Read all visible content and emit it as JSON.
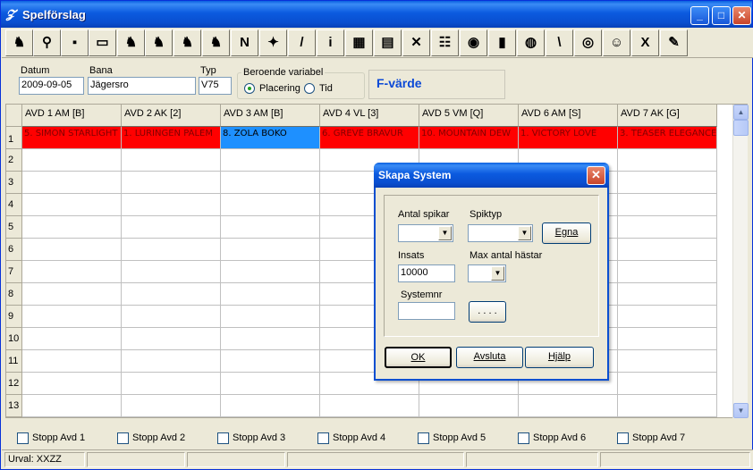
{
  "window": {
    "title": "Spelförslag"
  },
  "toolbar": {
    "icons": [
      "horse-icon",
      "binoculars-icon",
      "save-icon",
      "open-folder-icon",
      "horse-icon-2",
      "horse-icon-3",
      "horse-icon-4",
      "horse-icon-5",
      "horse-n-icon",
      "paw-icon",
      "pencil-icon",
      "info-icon",
      "grid-icon",
      "print-icon",
      "delete-icon",
      "calendar-icon",
      "globe-icon",
      "bar-chart-icon",
      "globe-arrow-icon",
      "wand-icon",
      "globe-search-icon",
      "person-icon",
      "excel-icon",
      "hand-icon"
    ],
    "glyphs": [
      "♞",
      "⚲",
      "▪",
      "▭",
      "♞",
      "♞",
      "♞",
      "♞",
      "N",
      "✦",
      "/",
      "i",
      "▦",
      "▤",
      "✕",
      "☷",
      "◉",
      "▮",
      "◍",
      "\\",
      "◎",
      "☺",
      "X",
      "✎"
    ]
  },
  "form": {
    "datum_label": "Datum",
    "datum_value": "2009-09-05",
    "bana_label": "Bana",
    "bana_value": "Jägersro",
    "typ_label": "Typ",
    "typ_value": "V75",
    "beroende_label": "Beroende variabel",
    "placering_label": "Placering",
    "tid_label": "Tid",
    "fvarde_label": "F-värde"
  },
  "grid": {
    "columns": [
      "AVD 1 AM  [B]",
      "AVD 2 AK  [2]",
      "AVD 3 AM  [B]",
      "AVD 4 VL  [3]",
      "AVD 5 VM  [Q]",
      "AVD 6 AM  [S]",
      "AVD 7 AK  [G]"
    ],
    "row_numbers": [
      "1",
      "2",
      "3",
      "4",
      "5",
      "6",
      "7",
      "8",
      "9",
      "10",
      "11",
      "12",
      "13"
    ],
    "row1": [
      "5. SIMON STARLIGHT",
      "1. LURINGEN PALEM",
      "8. ZOLA BOKO",
      "6. GREVE BRAVUR",
      "10. MOUNTAIN DEW",
      "1. VICTORY LOVE",
      "3. TEASER ELEGANCE"
    ]
  },
  "stopp": [
    "Stopp Avd 1",
    "Stopp Avd 2",
    "Stopp Avd 3",
    "Stopp Avd 4",
    "Stopp Avd 5",
    "Stopp Avd 6",
    "Stopp Avd 7"
  ],
  "status": {
    "urval": "Urval: XXZZ"
  },
  "dialog": {
    "title": "Skapa System",
    "antal_spikar_label": "Antal spikar",
    "spiktyp_label": "Spiktyp",
    "egna_label": "Egna",
    "insats_label": "Insats",
    "insats_value": "10000",
    "max_antal_label": "Max antal hästar",
    "systemnr_label": "Systemnr",
    "dots_label": ". . . .",
    "ok_label": "OK",
    "avsluta_label": "Avsluta",
    "hjalp_label": "Hjälp"
  },
  "colors": {
    "highlight_red": "#ff0000",
    "highlight_blue": "#1e90ff",
    "fvarde_blue": "#0b49d6"
  }
}
